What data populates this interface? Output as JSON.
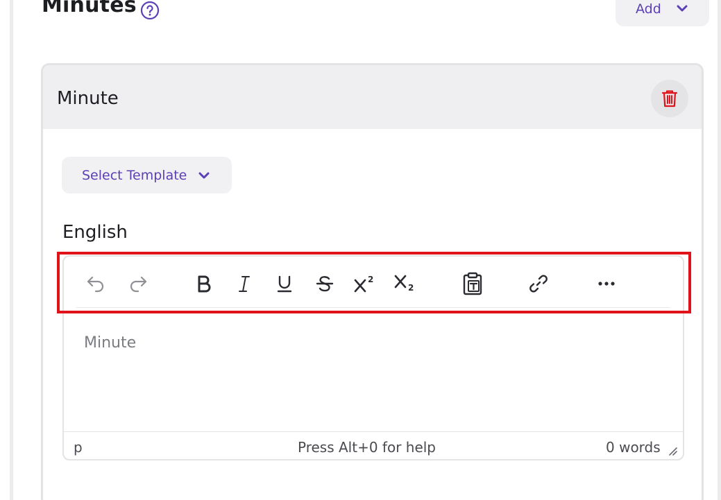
{
  "section": {
    "title": "Minutes",
    "add_label": "Add"
  },
  "card": {
    "title": "Minute",
    "template_label": "Select Template",
    "language_label": "English"
  },
  "editor": {
    "placeholder": "Minute",
    "status_path": "p",
    "status_help": "Press Alt+0 for help",
    "word_count": "0 words"
  },
  "colors": {
    "accent": "#5b3fb5",
    "danger": "#e0131a",
    "header_bg": "#efeff1"
  },
  "toolbar_icons": [
    "undo-icon",
    "redo-icon",
    "bold-icon",
    "italic-icon",
    "underline-icon",
    "strikethrough-icon",
    "superscript-icon",
    "subscript-icon",
    "paste-text-icon",
    "link-icon",
    "more-icon"
  ]
}
